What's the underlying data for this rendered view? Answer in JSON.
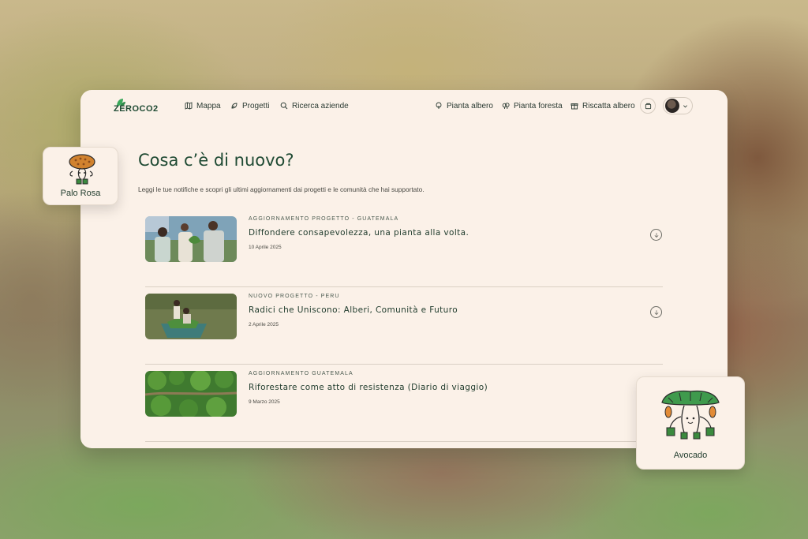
{
  "brand": {
    "logo_text": "ZEROCO2"
  },
  "nav": {
    "left": [
      {
        "label": "Mappa",
        "icon": "map-icon"
      },
      {
        "label": "Progetti",
        "icon": "projects-icon"
      },
      {
        "label": "Ricerca aziende",
        "icon": "search-icon"
      }
    ],
    "right": [
      {
        "label": "Pianta albero",
        "icon": "tree-icon"
      },
      {
        "label": "Pianta foresta",
        "icon": "forest-icon"
      },
      {
        "label": "Riscatta albero",
        "icon": "gift-icon"
      }
    ]
  },
  "page": {
    "title": "Cosa c’è di nuovo?",
    "subtitle": "Leggi le tue notifiche e scopri gli ultimi aggiornamenti dai progetti e le comunità che hai supportato."
  },
  "feed": [
    {
      "tag": "AGGIORNAMENTO PROGETTO - GUATEMALA",
      "headline": "Diffondere consapevolezza, una pianta alla volta.",
      "date": "10 Aprile 2025"
    },
    {
      "tag": "NUOVO PROGETTO - PERU",
      "headline": "Radici che Uniscono: Alberi, Comunità e Futuro",
      "date": "2 Aprile 2025"
    },
    {
      "tag": "AGGIORNAMENTO GUATEMALA",
      "headline": "Riforestare come atto di resistenza (Diario di viaggio)",
      "date": "9 Marzo 2025"
    }
  ],
  "cards": {
    "palo_rosa": "Palo Rosa",
    "avocado": "Avocado"
  },
  "colors": {
    "accent": "#1f4a33",
    "panel": "#fbf1e8",
    "leaf": "#3aa85b"
  }
}
